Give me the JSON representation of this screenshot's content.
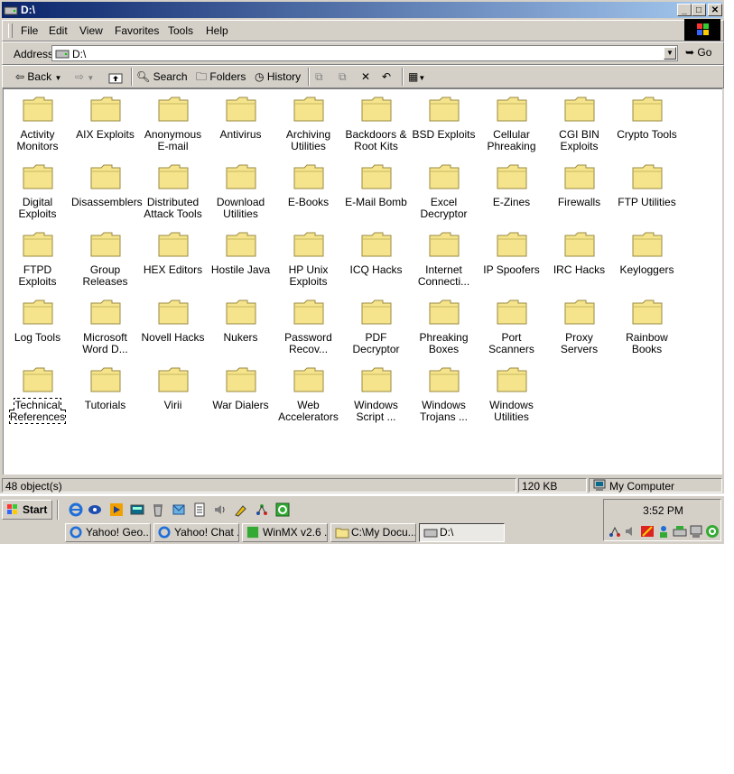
{
  "window": {
    "title": "D:\\",
    "buttons": {
      "minimize": "_",
      "maximize": "□",
      "close": "✕"
    }
  },
  "menu": [
    {
      "label": "File"
    },
    {
      "label": "Edit"
    },
    {
      "label": "View"
    },
    {
      "label": "Favorites"
    },
    {
      "label": "Tools"
    },
    {
      "label": "Help"
    }
  ],
  "address": {
    "label": "Address",
    "value": "D:\\",
    "go_label": "Go"
  },
  "toolbar": {
    "back": "Back",
    "search": "Search",
    "folders": "Folders",
    "history": "History"
  },
  "folders": [
    "Activity Monitors",
    "AIX Exploits",
    "Anonymous E-mail",
    "Antivirus",
    "Archiving Utilities",
    "Backdoors & Root Kits",
    "BSD Exploits",
    "Cellular Phreaking",
    "CGI BIN Exploits",
    "Crypto Tools",
    "Digital Exploits",
    "Disassemblers",
    "Distributed Attack Tools",
    "Download Utilities",
    "E-Books",
    "E-Mail Bomb",
    "Excel Decryptor",
    "E-Zines",
    "Firewalls",
    "FTP Utilities",
    "FTPD Exploits",
    "Group Releases",
    "HEX Editors",
    "Hostile Java",
    "HP Unix Exploits",
    "ICQ Hacks",
    "Internet Connecti...",
    "IP Spoofers",
    "IRC Hacks",
    "Keyloggers",
    "Log Tools",
    "Microsoft Word D...",
    "Novell Hacks",
    "Nukers",
    "Password Recov...",
    "PDF Decryptor",
    "Phreaking Boxes",
    "Port Scanners",
    "Proxy Servers",
    "Rainbow Books",
    "Technical References",
    "Tutorials",
    "Virii",
    "War Dialers",
    "Web Accelerators",
    "Windows Script ...",
    "Windows Trojans ...",
    "Windows Utilities"
  ],
  "selected_folder": "Technical References",
  "status": {
    "objects": "48 object(s)",
    "size": "120 KB",
    "location": "My Computer"
  },
  "taskbar": {
    "start": "Start",
    "clock": "3:52 PM",
    "tasks": [
      {
        "label": "Yahoo! Geo...",
        "icon": "ie-icon"
      },
      {
        "label": "Yahoo! Chat ...",
        "icon": "ie-icon"
      },
      {
        "label": "WinMX v2.6 ...",
        "icon": "winmx-icon"
      },
      {
        "label": "C:\\My Docu...",
        "icon": "folder-icon"
      },
      {
        "label": "D:\\",
        "icon": "drive-icon",
        "active": true
      }
    ]
  },
  "colors": {
    "title_start": "#0a246a",
    "title_end": "#a6caf0",
    "face": "#d4d0c8",
    "folder": "#f5e48c"
  }
}
